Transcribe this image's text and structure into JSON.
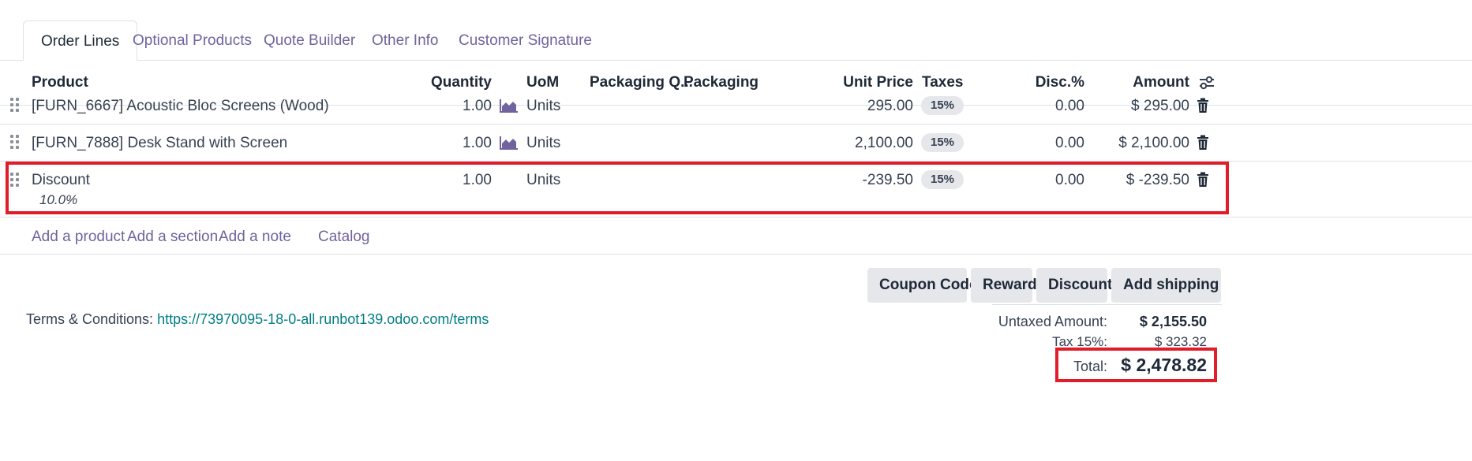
{
  "tabs": [
    {
      "label": "Order Lines",
      "active": true
    },
    {
      "label": "Optional Products"
    },
    {
      "label": "Quote Builder"
    },
    {
      "label": "Other Info"
    },
    {
      "label": "Customer Signature"
    }
  ],
  "columns": {
    "product": "Product",
    "quantity": "Quantity",
    "uom": "UoM",
    "packaging_qty": "Packaging Q...",
    "packaging": "Packaging",
    "unit_price": "Unit Price",
    "taxes": "Taxes",
    "disc": "Disc.%",
    "amount": "Amount"
  },
  "rows": [
    {
      "product": "[FURN_6667] Acoustic Bloc Screens (Wood)",
      "quantity": "1.00",
      "uom": "Units",
      "unit_price": "295.00",
      "tax": "15%",
      "disc": "0.00",
      "amount": "$ 295.00"
    },
    {
      "product": "[FURN_7888] Desk Stand with Screen",
      "quantity": "1.00",
      "uom": "Units",
      "unit_price": "2,100.00",
      "tax": "15%",
      "disc": "0.00",
      "amount": "$ 2,100.00"
    },
    {
      "product": "Discount",
      "subtitle": "10.0%",
      "quantity": "1.00",
      "uom": "Units",
      "unit_price": "-239.50",
      "tax": "15%",
      "disc": "0.00",
      "amount": "$ -239.50"
    }
  ],
  "add_links": {
    "product": "Add a product",
    "section": "Add a section",
    "note": "Add a note",
    "catalog": "Catalog"
  },
  "buttons": {
    "coupon": "Coupon Code",
    "reward": "Reward",
    "discount": "Discount",
    "shipping": "Add shipping"
  },
  "terms": {
    "label": "Terms & Conditions:",
    "link": "https://73970095-18-0-all.runbot139.odoo.com/terms"
  },
  "totals": {
    "untaxed_label": "Untaxed Amount:",
    "untaxed_value": "$ 2,155.50",
    "tax_label": "Tax 15%:",
    "tax_value": "$ 323.32",
    "total_label": "Total:",
    "total_value": "$ 2,478.82"
  },
  "colors": {
    "accent": "#71639e",
    "link": "#017e84",
    "highlight": "#e11d2a"
  }
}
